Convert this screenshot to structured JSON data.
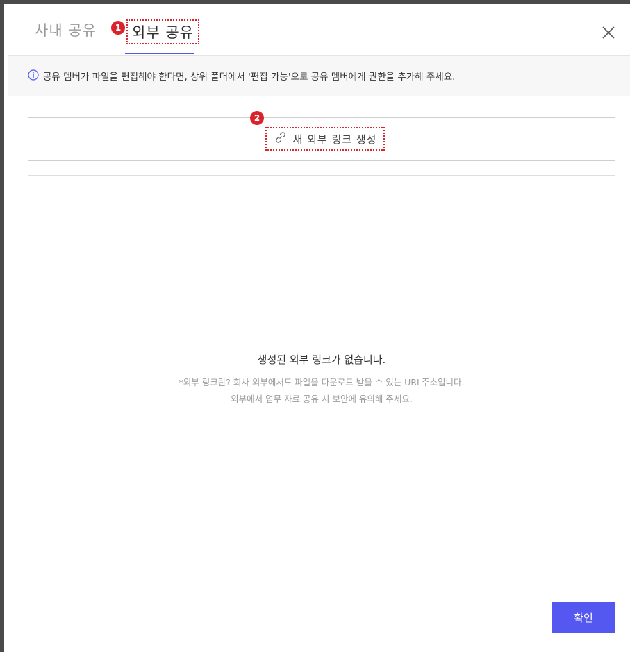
{
  "tabs": {
    "internal": "사내 공유",
    "external": "외부 공유"
  },
  "badges": {
    "one": "1",
    "two": "2"
  },
  "info": {
    "icon": "info-icon",
    "text": "공유 멤버가 파일을 편집해야 한다면, 상위 폴더에서 '편집 가능'으로 공유 멤버에게 권한을 추가해 주세요."
  },
  "actions": {
    "new_link_label": "새 외부 링크 생성",
    "new_link_icon": "link-icon",
    "confirm_label": "확인"
  },
  "empty_state": {
    "title": "생성된 외부 링크가 없습니다.",
    "line1": "*외부 링크란? 회사 외부에서도 파일을 다운로드 받을 수 있는 URL주소입니다.",
    "line2": "외부에서 업무 자료 공유 시 보안에 유의해 주세요."
  },
  "colors": {
    "accent": "#5458f0",
    "annotation": "#d9232d"
  }
}
